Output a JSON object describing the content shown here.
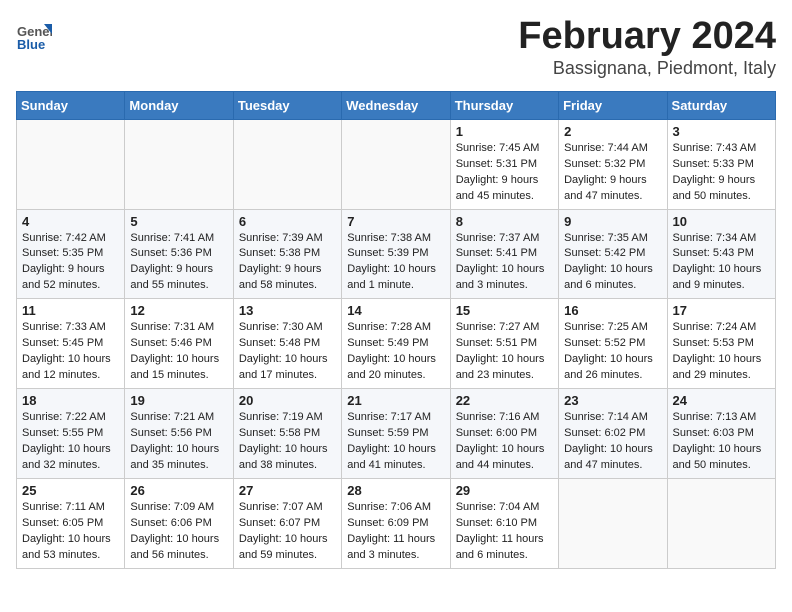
{
  "logo": {
    "general": "General",
    "blue": "Blue"
  },
  "title": "February 2024",
  "subtitle": "Bassignana, Piedmont, Italy",
  "days_header": [
    "Sunday",
    "Monday",
    "Tuesday",
    "Wednesday",
    "Thursday",
    "Friday",
    "Saturday"
  ],
  "weeks": [
    [
      {
        "day": "",
        "info": ""
      },
      {
        "day": "",
        "info": ""
      },
      {
        "day": "",
        "info": ""
      },
      {
        "day": "",
        "info": ""
      },
      {
        "day": "1",
        "info": "Sunrise: 7:45 AM\nSunset: 5:31 PM\nDaylight: 9 hours\nand 45 minutes."
      },
      {
        "day": "2",
        "info": "Sunrise: 7:44 AM\nSunset: 5:32 PM\nDaylight: 9 hours\nand 47 minutes."
      },
      {
        "day": "3",
        "info": "Sunrise: 7:43 AM\nSunset: 5:33 PM\nDaylight: 9 hours\nand 50 minutes."
      }
    ],
    [
      {
        "day": "4",
        "info": "Sunrise: 7:42 AM\nSunset: 5:35 PM\nDaylight: 9 hours\nand 52 minutes."
      },
      {
        "day": "5",
        "info": "Sunrise: 7:41 AM\nSunset: 5:36 PM\nDaylight: 9 hours\nand 55 minutes."
      },
      {
        "day": "6",
        "info": "Sunrise: 7:39 AM\nSunset: 5:38 PM\nDaylight: 9 hours\nand 58 minutes."
      },
      {
        "day": "7",
        "info": "Sunrise: 7:38 AM\nSunset: 5:39 PM\nDaylight: 10 hours\nand 1 minute."
      },
      {
        "day": "8",
        "info": "Sunrise: 7:37 AM\nSunset: 5:41 PM\nDaylight: 10 hours\nand 3 minutes."
      },
      {
        "day": "9",
        "info": "Sunrise: 7:35 AM\nSunset: 5:42 PM\nDaylight: 10 hours\nand 6 minutes."
      },
      {
        "day": "10",
        "info": "Sunrise: 7:34 AM\nSunset: 5:43 PM\nDaylight: 10 hours\nand 9 minutes."
      }
    ],
    [
      {
        "day": "11",
        "info": "Sunrise: 7:33 AM\nSunset: 5:45 PM\nDaylight: 10 hours\nand 12 minutes."
      },
      {
        "day": "12",
        "info": "Sunrise: 7:31 AM\nSunset: 5:46 PM\nDaylight: 10 hours\nand 15 minutes."
      },
      {
        "day": "13",
        "info": "Sunrise: 7:30 AM\nSunset: 5:48 PM\nDaylight: 10 hours\nand 17 minutes."
      },
      {
        "day": "14",
        "info": "Sunrise: 7:28 AM\nSunset: 5:49 PM\nDaylight: 10 hours\nand 20 minutes."
      },
      {
        "day": "15",
        "info": "Sunrise: 7:27 AM\nSunset: 5:51 PM\nDaylight: 10 hours\nand 23 minutes."
      },
      {
        "day": "16",
        "info": "Sunrise: 7:25 AM\nSunset: 5:52 PM\nDaylight: 10 hours\nand 26 minutes."
      },
      {
        "day": "17",
        "info": "Sunrise: 7:24 AM\nSunset: 5:53 PM\nDaylight: 10 hours\nand 29 minutes."
      }
    ],
    [
      {
        "day": "18",
        "info": "Sunrise: 7:22 AM\nSunset: 5:55 PM\nDaylight: 10 hours\nand 32 minutes."
      },
      {
        "day": "19",
        "info": "Sunrise: 7:21 AM\nSunset: 5:56 PM\nDaylight: 10 hours\nand 35 minutes."
      },
      {
        "day": "20",
        "info": "Sunrise: 7:19 AM\nSunset: 5:58 PM\nDaylight: 10 hours\nand 38 minutes."
      },
      {
        "day": "21",
        "info": "Sunrise: 7:17 AM\nSunset: 5:59 PM\nDaylight: 10 hours\nand 41 minutes."
      },
      {
        "day": "22",
        "info": "Sunrise: 7:16 AM\nSunset: 6:00 PM\nDaylight: 10 hours\nand 44 minutes."
      },
      {
        "day": "23",
        "info": "Sunrise: 7:14 AM\nSunset: 6:02 PM\nDaylight: 10 hours\nand 47 minutes."
      },
      {
        "day": "24",
        "info": "Sunrise: 7:13 AM\nSunset: 6:03 PM\nDaylight: 10 hours\nand 50 minutes."
      }
    ],
    [
      {
        "day": "25",
        "info": "Sunrise: 7:11 AM\nSunset: 6:05 PM\nDaylight: 10 hours\nand 53 minutes."
      },
      {
        "day": "26",
        "info": "Sunrise: 7:09 AM\nSunset: 6:06 PM\nDaylight: 10 hours\nand 56 minutes."
      },
      {
        "day": "27",
        "info": "Sunrise: 7:07 AM\nSunset: 6:07 PM\nDaylight: 10 hours\nand 59 minutes."
      },
      {
        "day": "28",
        "info": "Sunrise: 7:06 AM\nSunset: 6:09 PM\nDaylight: 11 hours\nand 3 minutes."
      },
      {
        "day": "29",
        "info": "Sunrise: 7:04 AM\nSunset: 6:10 PM\nDaylight: 11 hours\nand 6 minutes."
      },
      {
        "day": "",
        "info": ""
      },
      {
        "day": "",
        "info": ""
      }
    ]
  ]
}
